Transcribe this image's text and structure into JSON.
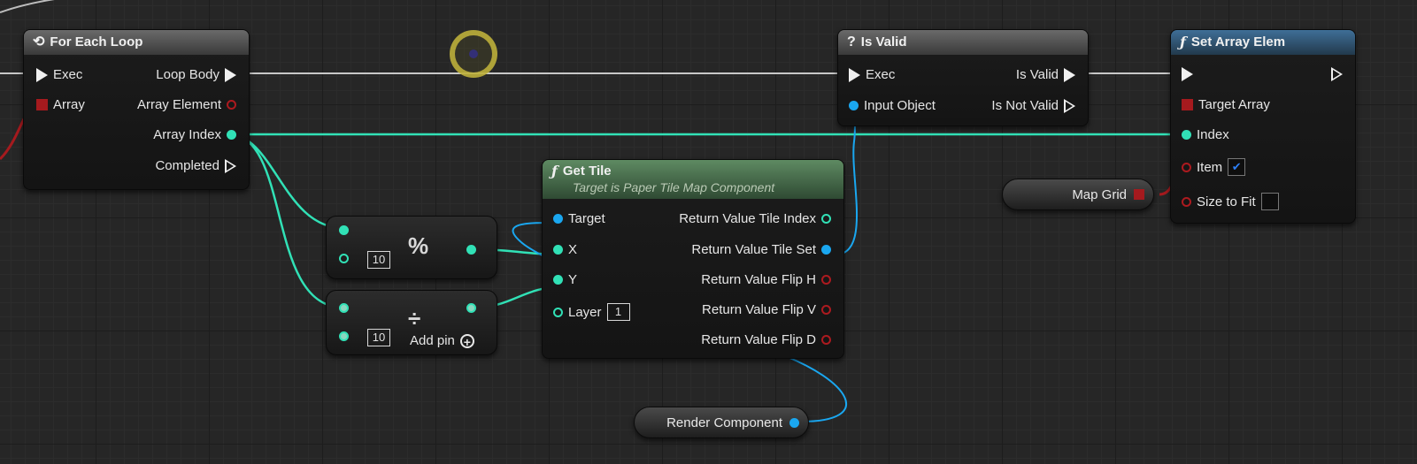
{
  "nodes": {
    "for_each": {
      "title": "For Each Loop",
      "icon": "loop-icon",
      "exec_in": "Exec",
      "loop_body": "Loop Body",
      "array": "Array",
      "array_element": "Array Element",
      "array_index": "Array Index",
      "completed": "Completed"
    },
    "is_valid": {
      "title": "Is Valid",
      "icon": "question-icon",
      "exec_in": "Exec",
      "input_object": "Input Object",
      "is_valid_out": "Is Valid",
      "is_not_valid_out": "Is Not Valid"
    },
    "set_array_elem": {
      "title": "Set Array Elem",
      "icon": "function-icon",
      "target_array": "Target Array",
      "index": "Index",
      "item": "Item",
      "size_to_fit": "Size to Fit",
      "item_checked": true,
      "size_to_fit_checked": false
    },
    "get_tile": {
      "title": "Get Tile",
      "subtitle": "Target is Paper Tile Map Component",
      "icon": "function-icon",
      "target": "Target",
      "x": "X",
      "y": "Y",
      "layer": "Layer",
      "layer_value": "1",
      "ret_tile_index": "Return Value Tile Index",
      "ret_tile_set": "Return Value Tile Set",
      "ret_flip_h": "Return Value Flip H",
      "ret_flip_v": "Return Value Flip V",
      "ret_flip_d": "Return Value Flip D"
    },
    "modulo": {
      "operator": "%",
      "value": "10"
    },
    "divide": {
      "operator": "÷",
      "value": "10",
      "add_pin": "Add pin"
    },
    "map_grid": {
      "label": "Map Grid"
    },
    "render_component": {
      "label": "Render Component"
    }
  },
  "colors": {
    "exec_wire": "#c8c8c8",
    "int_wire": "#31e1b6",
    "object_wire": "#1aa7f0",
    "struct_wire": "#a51a1e"
  }
}
